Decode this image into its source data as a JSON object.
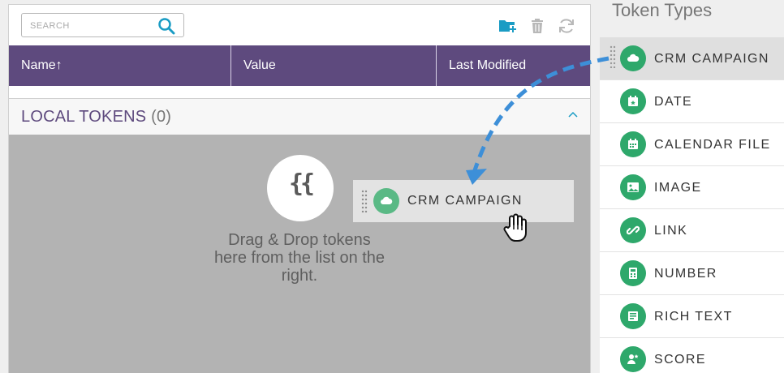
{
  "search": {
    "placeholder": "SEARCH"
  },
  "toolbar": {
    "new_folder_icon": "folder-plus-icon",
    "delete_icon": "trash-icon",
    "refresh_icon": "refresh-icon"
  },
  "table": {
    "columns": [
      "Name↑",
      "Value",
      "Last Modified"
    ]
  },
  "local_tokens": {
    "title": "LOCAL TOKENS",
    "count": "(0)"
  },
  "drop_zone": {
    "icon_text": "{{",
    "message": "Drag & Drop tokens here from the list on the right."
  },
  "dragged_token": {
    "label": "CRM CAMPAIGN",
    "icon": "cloud-icon"
  },
  "token_types": {
    "title": "Token Types",
    "items": [
      {
        "label": "CRM CAMPAIGN",
        "icon": "cloud-icon"
      },
      {
        "label": "DATE",
        "icon": "calendar-date-icon"
      },
      {
        "label": "CALENDAR FILE",
        "icon": "calendar-file-icon"
      },
      {
        "label": "IMAGE",
        "icon": "image-icon"
      },
      {
        "label": "LINK",
        "icon": "link-icon"
      },
      {
        "label": "NUMBER",
        "icon": "calculator-icon"
      },
      {
        "label": "RICH TEXT",
        "icon": "rich-text-icon"
      },
      {
        "label": "SCORE",
        "icon": "score-icon"
      }
    ]
  },
  "colors": {
    "accent_purple": "#5e4a7e",
    "token_green": "#2ea86b",
    "teal_icon": "#1a9cc4",
    "arrow_blue": "#3d8fd8"
  }
}
